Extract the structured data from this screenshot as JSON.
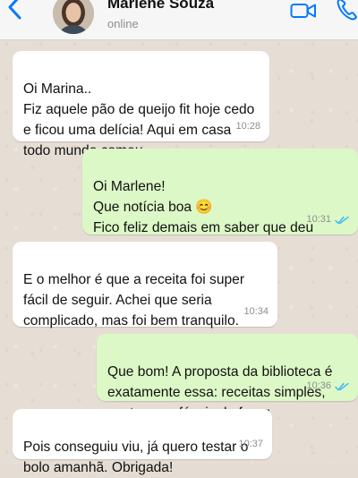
{
  "header": {
    "contact_name": "Marlene Souza",
    "status": "online"
  },
  "messages": [
    {
      "direction": "in",
      "text": "Oi Marina..\nFiz aquele pão de queijo fit hoje cedo e ficou uma delícia! Aqui em casa todo mundo comeu.",
      "time": "10:28"
    },
    {
      "direction": "out",
      "text": "Oi Marlene!\nQue notícia boa 😊\nFico feliz demais em saber que deu certo e que vocês gostaram.",
      "time": "10:31",
      "read": true
    },
    {
      "direction": "in",
      "text": "E o melhor é que a receita foi super fácil de seguir. Achei que seria complicado, mas foi bem tranquilo.",
      "time": "10:34"
    },
    {
      "direction": "out",
      "text": "Que bom! A proposta da biblioteca é exatamente essa: receitas simples, gostosas e fáceis de fazer.",
      "time": "10:36",
      "read": true
    },
    {
      "direction": "in",
      "text": "Pois conseguiu viu, já quero testar o bolo amanhã. Obrigada!",
      "time": "10:37"
    }
  ],
  "colors": {
    "accent": "#007aff",
    "incoming_bubble": "#ffffff",
    "outgoing_bubble": "#dcf8c6",
    "read_ticks": "#34b7f1",
    "chat_background": "#e6ded5"
  },
  "icons": [
    "back-chevron-icon",
    "video-call-icon",
    "phone-call-icon",
    "double-check-icon"
  ]
}
